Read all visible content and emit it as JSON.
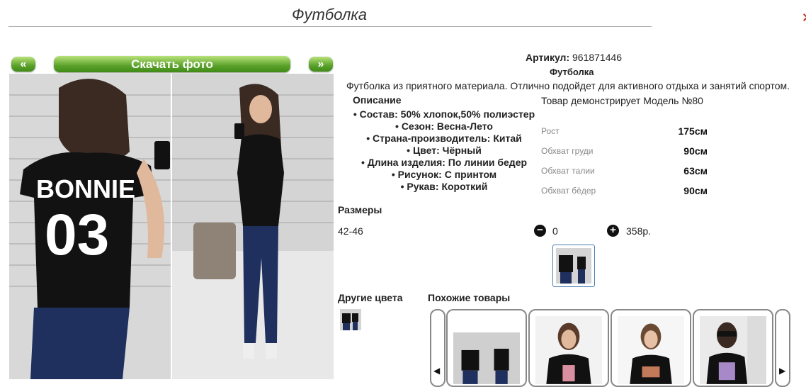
{
  "header": {
    "title": "Футболка",
    "close_mark": "⨯"
  },
  "gallery": {
    "prev_label": "«",
    "next_label": "»",
    "download_label": "Скачать фото"
  },
  "product": {
    "article_label": "Артикул:",
    "article_value": "961871446",
    "name": "Футболка",
    "description": "Футболка из приятного материала. Отлично подойдет для активного отдыха и занятий спортом.",
    "description_heading": "Описание",
    "properties": [
      "• Состав: 50% хлопок,50% полиэстер",
      "• Сезон: Весна-Лето",
      "• Страна-производитель: Китай",
      "• Цвет: Чёрный",
      "• Длина изделия: По линии бедер",
      "• Рисунок: С принтом",
      "• Рукав: Короткий"
    ]
  },
  "model": {
    "line": "Товар демонстрирует Модель №80",
    "measurements": [
      {
        "label": "Рост",
        "value": "175см"
      },
      {
        "label": "Обхват груди",
        "value": "90см"
      },
      {
        "label": "Обхват талии",
        "value": "63см"
      },
      {
        "label": "Обхват бёдер",
        "value": "90см"
      }
    ]
  },
  "sizes": {
    "heading": "Размеры",
    "rows": [
      {
        "size": "42-46",
        "quantity": "0",
        "price": "358р."
      }
    ],
    "minus_label": "−",
    "plus_label": "+"
  },
  "other_colors": {
    "heading": "Другие цвета"
  },
  "similar": {
    "heading": "Похожие товары",
    "left_arrow": "◀",
    "right_arrow": "▶"
  }
}
